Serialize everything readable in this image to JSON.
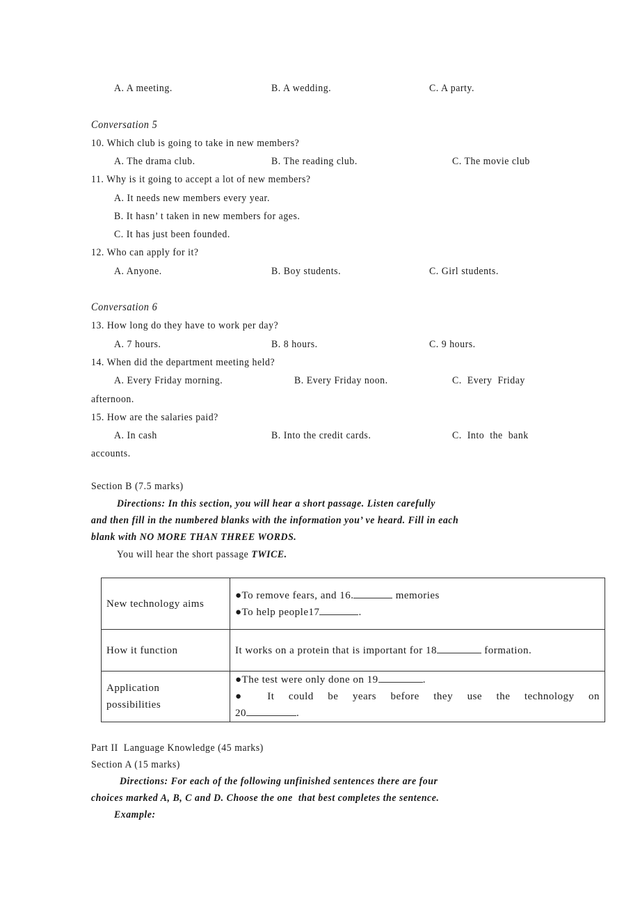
{
  "prev_question_options": [
    "A. A meeting.",
    "B. A wedding.",
    "C. A party."
  ],
  "conversation5": {
    "title": "Conversation 5",
    "q10": {
      "text": "10. Which club is going to take in new members?",
      "options": [
        "A. The drama club.",
        "B. The reading club.",
        "C. The movie club"
      ]
    },
    "q11": {
      "text": "11. Why is it going to accept a lot of new members?",
      "options": [
        "A. It needs new members every year.",
        "B. It hasn’ t taken in new members for ages.",
        "C. It has just been founded."
      ]
    },
    "q12": {
      "text": "12. Who can apply for it?",
      "options": [
        "A. Anyone.",
        "B. Boy students.",
        "C. Girl students."
      ]
    }
  },
  "conversation6": {
    "title": "Conversation 6",
    "q13": {
      "text": "13. How long do they have to work per day?",
      "options": [
        "A. 7 hours.",
        "B. 8 hours.",
        "C. 9 hours."
      ]
    },
    "q14": {
      "text": "14. When did the department meeting held?",
      "options": [
        "A. Every Friday morning.",
        "B. Every Friday noon.",
        "C.  Every  Friday"
      ],
      "wrap": "afternoon."
    },
    "q15": {
      "text": "15. How are the salaries paid?",
      "options": [
        "A. In cash",
        "B. Into the credit cards.",
        "C.  Into  the  bank"
      ],
      "wrap": "accounts."
    }
  },
  "section_b": {
    "title": "Section B (7.5 marks)",
    "directions_lines": [
      "Directions: In this section, you will hear a short passage. Listen carefully",
      "and then fill in the numbered blanks with the information you’ ve heard. Fill in each",
      "blank with NO MORE THAN THREE WORDS."
    ],
    "hear_prefix": "You will hear the short passage ",
    "hear_emph": "TWICE.",
    "table": [
      {
        "label": "New technology aims",
        "lines": [
          "●To remove fears, and 16.",
          " memories",
          "●To help people17",
          "."
        ]
      },
      {
        "label": "How it function",
        "lines": [
          "It works on a protein that is important for 18",
          " formation."
        ]
      },
      {
        "label_lines": [
          "Application",
          "possibilities"
        ],
        "lines": [
          "●The test were only done on 19",
          ".",
          "● It could be years before they use the technology on",
          "20",
          "."
        ]
      }
    ]
  },
  "part2": {
    "title": "Part II  Language Knowledge (45 marks)",
    "section_a_title": "Section A (15 marks)",
    "directions_lines": [
      "Directions: For each of the following unfinished sentences there are four",
      "choices marked A, B, C and D. Choose the one  that best completes the sentence."
    ],
    "example_label": "Example:"
  }
}
